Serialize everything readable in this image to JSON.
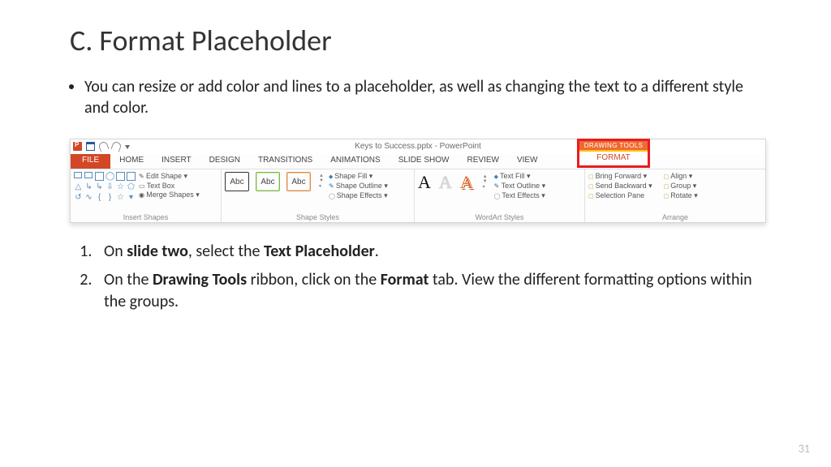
{
  "title": "C. Format Placeholder",
  "bullet": "You can resize or add color and lines to a placeholder, as well as changing the text to a different style and color.",
  "steps": {
    "s1_pre": "On ",
    "s1_b1": "slide two",
    "s1_mid": ", select the ",
    "s1_b2": "Text Placeholder",
    "s1_post": ".",
    "s2_pre": "On the ",
    "s2_b1": "Drawing Tools",
    "s2_mid": " ribbon, click on the ",
    "s2_b2": "Format",
    "s2_post": " tab. View the different formatting options within the groups."
  },
  "page_number": "31",
  "ribbon": {
    "doc_title": "Keys to Success.pptx - PowerPoint",
    "context_top": "DRAWING TOOLS",
    "context_bottom": "FORMAT",
    "tabs": {
      "file": "FILE",
      "home": "HOME",
      "insert": "INSERT",
      "design": "DESIGN",
      "transitions": "TRANSITIONS",
      "animations": "ANIMATIONS",
      "slideshow": "SLIDE SHOW",
      "review": "REVIEW",
      "view": "VIEW"
    },
    "groups": {
      "insert_shapes": {
        "label": "Insert Shapes",
        "edit_shape": "Edit Shape ▾",
        "text_box": "Text Box",
        "merge": "Merge Shapes ▾"
      },
      "shape_styles": {
        "label": "Shape Styles",
        "abc": "Abc",
        "fill": "Shape Fill ▾",
        "outline": "Shape Outline ▾",
        "effects": "Shape Effects ▾"
      },
      "wordart": {
        "label": "WordArt Styles",
        "A": "A",
        "fill": "Text Fill ▾",
        "outline": "Text Outline ▾",
        "effects": "Text Effects ▾"
      },
      "arrange": {
        "label": "Arrange",
        "bring": "Bring Forward ▾",
        "send": "Send Backward ▾",
        "pane": "Selection Pane",
        "align": "Align ▾",
        "group": "Group ▾",
        "rotate": "Rotate ▾"
      }
    }
  }
}
